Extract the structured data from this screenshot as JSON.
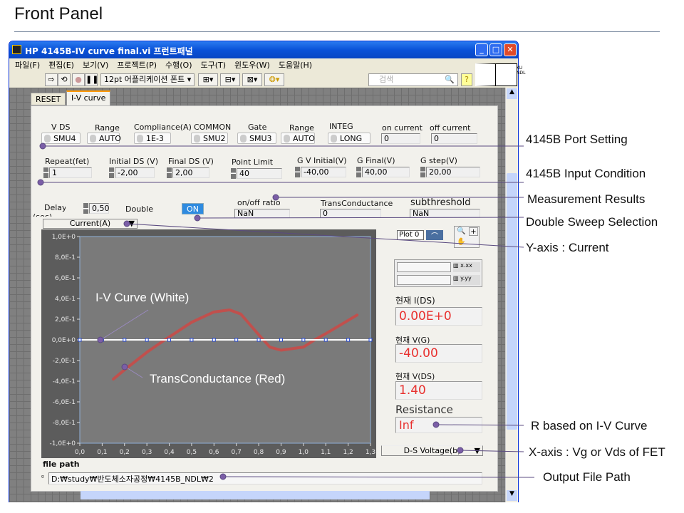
{
  "slide": {
    "title": "Front Panel"
  },
  "window": {
    "title": "HP 4145B-IV curve final.vi 프런트패널",
    "menu": [
      "파일(F)",
      "편집(E)",
      "보기(V)",
      "프로젝트(P)",
      "수행(O)",
      "도구(T)",
      "윈도우(W)",
      "도움말(H)"
    ],
    "font_select": "12pt 어플리케이션 폰트",
    "search_placeholder": "검색",
    "logo": "KU NDL",
    "tabs": [
      "RESET",
      "I-V curve"
    ]
  },
  "port": {
    "vds": {
      "label": "V DS",
      "value": "SMU4"
    },
    "range1": {
      "label": "Range",
      "value": "AUTO"
    },
    "compliance": {
      "label": "Compliance(A)",
      "value": "1E-3"
    },
    "common": {
      "label": "COMMON",
      "value": "SMU2"
    },
    "gate": {
      "label": "Gate",
      "value": "SMU3"
    },
    "range2": {
      "label": "Range",
      "value": "AUTO"
    },
    "integ": {
      "label": "INTEG",
      "value": "LONG"
    },
    "on_current": {
      "label": "on current",
      "value": "0"
    },
    "off_current": {
      "label": "off current",
      "value": "0"
    }
  },
  "input": {
    "repeat": {
      "label": "Repeat(fet)",
      "value": "1"
    },
    "initial_ds": {
      "label": "Initial DS (V)",
      "value": "-2,00"
    },
    "final_ds": {
      "label": "Final DS (V)",
      "value": "2,00"
    },
    "point_limit": {
      "label": "Point Limit",
      "value": "40"
    },
    "gv_initial": {
      "label": "G V Initial(V)",
      "value": "-40,00"
    },
    "g_final": {
      "label": "G Final(V)",
      "value": "40,00"
    },
    "g_step": {
      "label": "G step(V)",
      "value": "20,00"
    }
  },
  "results": {
    "delay": {
      "label": "Delay (sec)",
      "value": "0,50"
    },
    "double": {
      "label": "Double",
      "button": "ON"
    },
    "onoff": {
      "label": "on/off ratio",
      "value": "NaN"
    },
    "transconductance": {
      "label": "TransConductance",
      "value": "0"
    },
    "subthreshold": {
      "label": "subthreshold",
      "value": "NaN"
    }
  },
  "graph": {
    "y_select": "Current(A)",
    "x_select": "D-S Voltage(b)",
    "legend": "Plot 0"
  },
  "readouts": {
    "ids": {
      "label": "현재 I(DS)",
      "value": "0.00E+0"
    },
    "vg": {
      "label": "현재 V(G)",
      "value": "-40.00"
    },
    "vds": {
      "label": "현재 V(DS)",
      "value": "1.40"
    },
    "resistance": {
      "label": "Resistance",
      "value": "Inf"
    }
  },
  "file": {
    "label": "file path",
    "value": "D:₩study₩반도체소자공정₩4145B_NDL₩2"
  },
  "annotations": {
    "port": "4145B Port Setting",
    "input": "4145B Input Condition",
    "results": "Measurement Results",
    "double": "Double Sweep Selection",
    "yaxis": "Y-axis : Current",
    "r": "R based on I-V Curve",
    "xaxis": "X-axis : Vg or Vds of FET",
    "output": "Output File Path",
    "iv": "I-V Curve (White)",
    "tc": "TransConductance (Red)"
  },
  "chart_data": {
    "type": "line",
    "xlim": [
      0,
      1.3
    ],
    "ylim": [
      -1,
      1
    ],
    "x_ticks": [
      "0,0",
      "0,1",
      "0,2",
      "0,3",
      "0,4",
      "0,5",
      "0,6",
      "0,7",
      "0,8",
      "0,9",
      "1,0",
      "1,1",
      "1,2",
      "1,3"
    ],
    "y_ticks": [
      "1,0E+0",
      "8,0E-1",
      "6,0E-1",
      "4,0E-1",
      "2,0E-1",
      "0,0E+0",
      "-2,0E-1",
      "-4,0E-1",
      "-6,0E-1",
      "-8,0E-1",
      "-1,0E+0"
    ],
    "series": [
      {
        "name": "I-V Curve",
        "color": "#ffffff",
        "x": [
          0,
          0.1,
          0.2,
          0.3,
          0.4,
          0.5,
          0.6,
          0.7,
          0.8,
          0.9,
          1.0,
          1.1,
          1.2,
          1.3
        ],
        "y": [
          0,
          0,
          0,
          0,
          0,
          0,
          0,
          0,
          0,
          0,
          0,
          0,
          0,
          0
        ]
      },
      {
        "name": "TransConductance",
        "color": "#c0504d",
        "x": [
          0.15,
          0.2,
          0.3,
          0.38,
          0.5,
          0.6,
          0.67,
          0.72,
          0.8,
          0.85,
          0.9,
          1.0,
          1.05,
          1.1,
          1.24
        ],
        "y": [
          -0.38,
          -0.29,
          -0.12,
          0,
          0.17,
          0.27,
          0.29,
          0.25,
          0.05,
          -0.07,
          -0.1,
          -0.07,
          0,
          0.06,
          0.24
        ]
      }
    ]
  }
}
